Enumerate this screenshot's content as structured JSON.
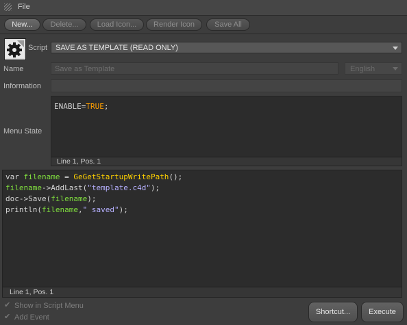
{
  "menubar": {
    "file_label": "File"
  },
  "toolbar": {
    "new": "New...",
    "delete": "Delete...",
    "load_icon": "Load Icon...",
    "render_icon": "Render Icon",
    "save_all": "Save All"
  },
  "script": {
    "label": "Script",
    "selected": "SAVE AS TEMPLATE (READ ONLY)",
    "icon": "gear-document-icon"
  },
  "name": {
    "label": "Name",
    "placeholder": "Save as Template",
    "language": "English"
  },
  "information": {
    "label": "Information",
    "value": ""
  },
  "menu_state": {
    "label": "Menu State",
    "code": [
      [
        {
          "t": "ENABLE=",
          "c": "def"
        },
        {
          "t": "TRUE",
          "c": "kw"
        },
        {
          "t": ";",
          "c": "def"
        }
      ]
    ],
    "status": "Line 1, Pos. 1"
  },
  "editor": {
    "code": [
      [
        {
          "t": "var ",
          "c": "def"
        },
        {
          "t": "filename",
          "c": "var"
        },
        {
          "t": " = ",
          "c": "def"
        },
        {
          "t": "GeGetStartupWritePath",
          "c": "fn"
        },
        {
          "t": "();",
          "c": "def"
        }
      ],
      [
        {
          "t": "filename",
          "c": "var"
        },
        {
          "t": "->AddLast(",
          "c": "def"
        },
        {
          "t": "\"template.c4d\"",
          "c": "str"
        },
        {
          "t": ");",
          "c": "def"
        }
      ],
      [
        {
          "t": "doc->Save(",
          "c": "def"
        },
        {
          "t": "filename",
          "c": "var"
        },
        {
          "t": ");",
          "c": "def"
        }
      ],
      [
        {
          "t": "println(",
          "c": "def"
        },
        {
          "t": "filename",
          "c": "var"
        },
        {
          "t": ",",
          "c": "def"
        },
        {
          "t": "\" saved\"",
          "c": "str"
        },
        {
          "t": ");",
          "c": "def"
        }
      ]
    ],
    "status": "Line 1, Pos. 1"
  },
  "options": {
    "show_in_menu": {
      "label": "Show in Script Menu",
      "checked": true
    },
    "add_event": {
      "label": "Add Event",
      "checked": true
    }
  },
  "buttons": {
    "shortcut": "Shortcut...",
    "execute": "Execute"
  }
}
